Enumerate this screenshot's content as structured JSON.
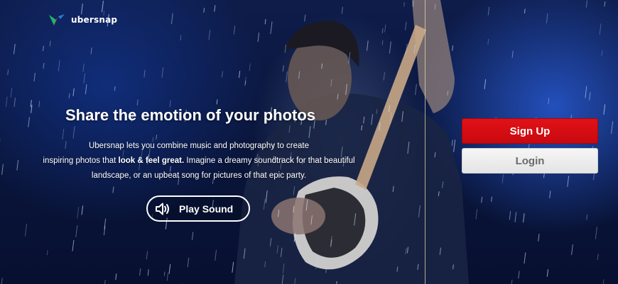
{
  "brand": {
    "name": "ubersnap",
    "logo_icon": "ubersnap-logo-icon",
    "logo_colors": [
      "#1fb56a",
      "#e8452c",
      "#2a7ad8"
    ]
  },
  "hero": {
    "background_image": "guitarist performing in rain with blue stage lights",
    "headline": "Share the emotion of your photos",
    "description": {
      "line1": "Ubersnap lets you combine music and photography to create",
      "line2_pre": "inspiring photos that ",
      "line2_bold": "look & feel great.",
      "line2_post": " Imagine a dreamy soundtrack for that beautiful",
      "line3": "landscape, or an upbeat song for pictures of that epic party."
    },
    "play_button": {
      "label": "Play Sound",
      "icon": "speaker-icon"
    }
  },
  "auth": {
    "signup_label": "Sign Up",
    "login_label": "Login",
    "signup_color": "#d50d13",
    "login_color": "#eeeeee"
  }
}
